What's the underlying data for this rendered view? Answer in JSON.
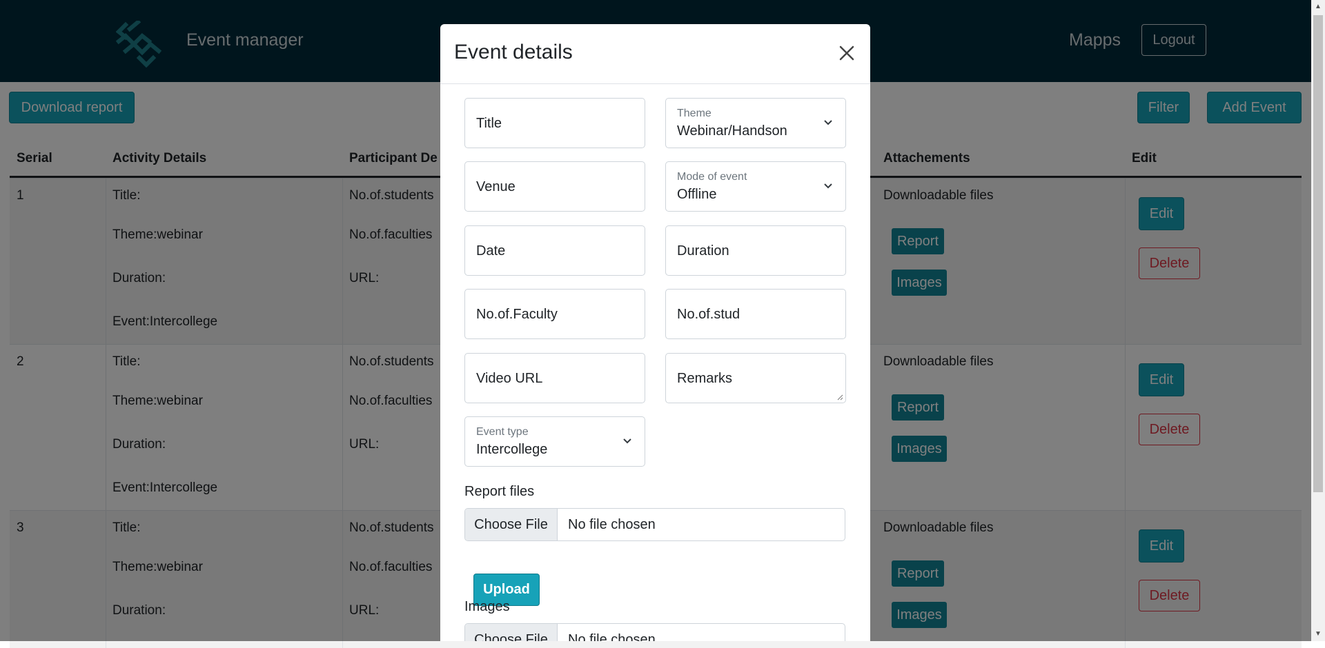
{
  "app": {
    "title": "Event manager",
    "brand_link": "Mapps",
    "logout": "Logout"
  },
  "toolbar": {
    "download": "Download report",
    "filter": "Filter",
    "add_event": "Add Event"
  },
  "table": {
    "headers": [
      "Serial",
      "Activity Details",
      "Participant De",
      "Attachements",
      "Edit"
    ],
    "rows": [
      {
        "serial": "1",
        "activity": [
          "Title:",
          "Theme:webinar",
          "Duration:",
          "Event:Intercollege"
        ],
        "participants": [
          "No.of.students",
          "No.of.faculties",
          "URL:"
        ],
        "attach_label": "Downloadable files",
        "report": "Report",
        "images": "Images",
        "edit": "Edit",
        "delete": "Delete"
      },
      {
        "serial": "2",
        "activity": [
          "Title:",
          "Theme:webinar",
          "Duration:",
          "Event:Intercollege"
        ],
        "participants": [
          "No.of.students",
          "No.of.faculties",
          "URL:"
        ],
        "attach_label": "Downloadable files",
        "report": "Report",
        "images": "Images",
        "edit": "Edit",
        "delete": "Delete"
      },
      {
        "serial": "3",
        "activity": [
          "Title:",
          "Theme:webinar",
          "Duration:"
        ],
        "participants": [
          "No.of.students",
          "No.of.faculties",
          "URL:"
        ],
        "attach_label": "Downloadable files",
        "report": "Report",
        "images": "Images",
        "edit": "Edit",
        "delete": "Delete"
      }
    ]
  },
  "modal": {
    "title": "Event details",
    "fields": {
      "title_placeholder": "Title",
      "theme_label": "Theme",
      "theme_value": "Webinar/Handson",
      "venue_placeholder": "Venue",
      "mode_label": "Mode of event",
      "mode_value": "Offline",
      "date_placeholder": "Date",
      "duration_placeholder": "Duration",
      "faculty_placeholder": "No.of.Faculty",
      "stud_placeholder": "No.of.stud",
      "video_placeholder": "Video URL",
      "remarks_placeholder": "Remarks",
      "event_type_label": "Event type",
      "event_type_value": "Intercollege"
    },
    "report_files_label": "Report files",
    "choose_file": "Choose File",
    "no_file": "No file chosen",
    "upload": "Upload",
    "images_label": "Images",
    "choose_file_2": "Choose File",
    "no_file_2": "No file chosen"
  },
  "colors": {
    "navbar": "#002b3b",
    "accent": "#17a2b8",
    "danger": "#dc3545"
  }
}
